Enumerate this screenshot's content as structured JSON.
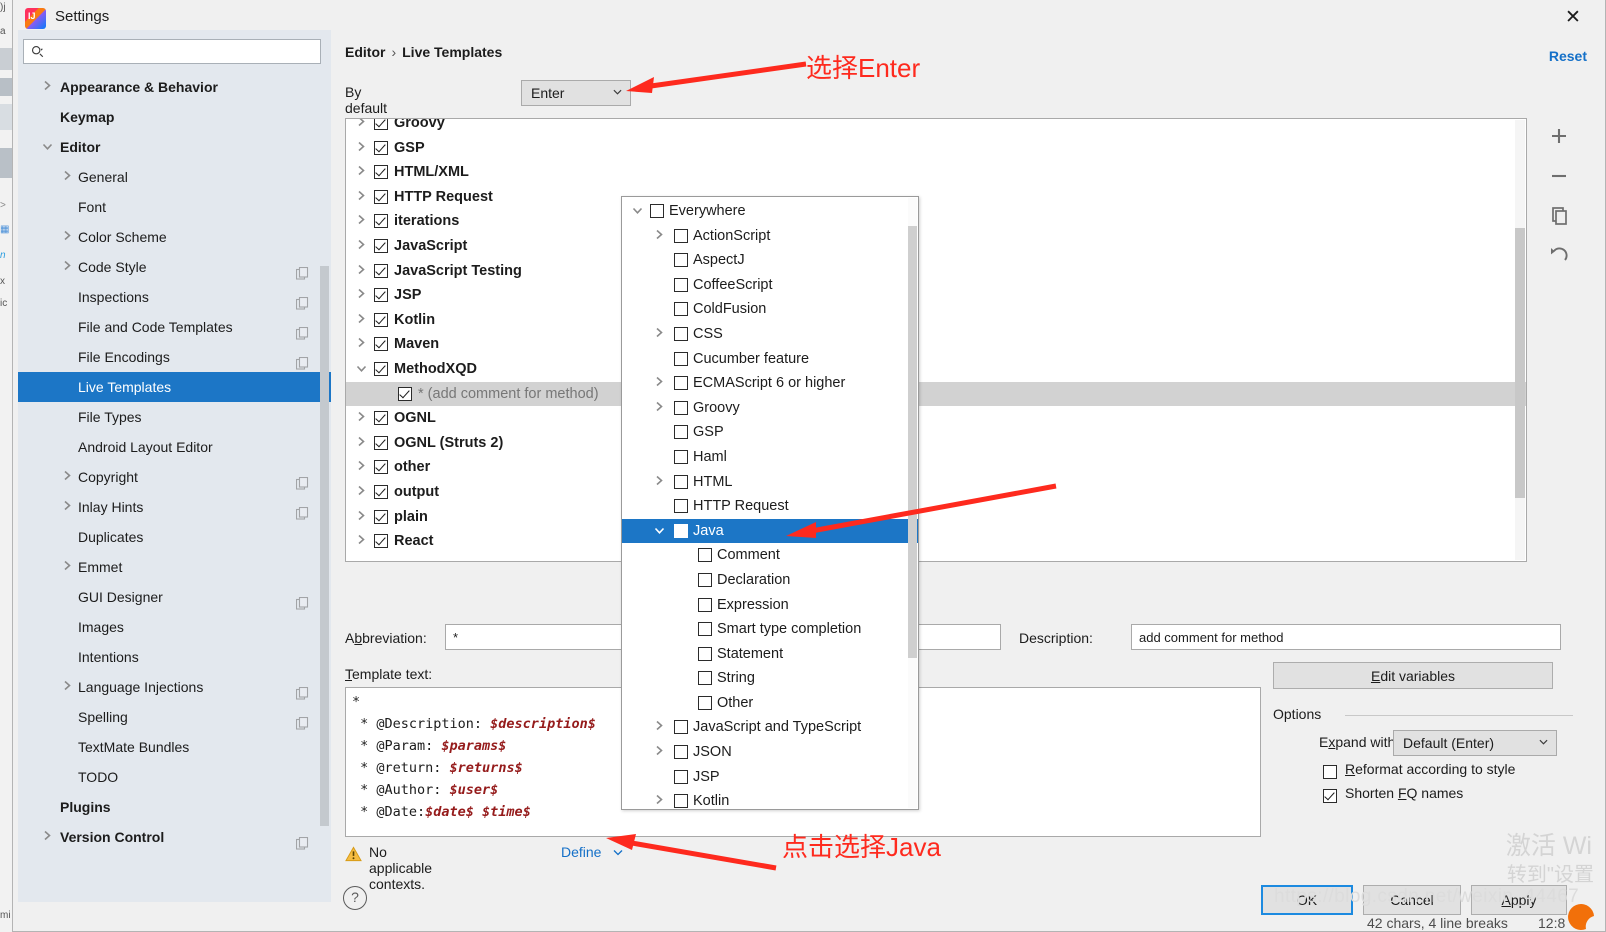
{
  "window": {
    "title": "Settings",
    "app_icon": "intellij-idea-icon",
    "close_icon": "close-icon"
  },
  "sidebar": {
    "search": {
      "placeholder": "",
      "value": "",
      "icon": "search-icon"
    },
    "items": [
      {
        "label": "Appearance & Behavior",
        "level": 0,
        "chevron": "right",
        "bold": true,
        "selected": false,
        "config_icon": false
      },
      {
        "label": "Keymap",
        "level": 0,
        "chevron": "",
        "bold": true,
        "selected": false,
        "config_icon": false
      },
      {
        "label": "Editor",
        "level": 0,
        "chevron": "down",
        "bold": true,
        "selected": false,
        "config_icon": false
      },
      {
        "label": "General",
        "level": 1,
        "chevron": "right",
        "bold": false,
        "selected": false,
        "config_icon": false
      },
      {
        "label": "Font",
        "level": 1,
        "chevron": "",
        "bold": false,
        "selected": false,
        "config_icon": false
      },
      {
        "label": "Color Scheme",
        "level": 1,
        "chevron": "right",
        "bold": false,
        "selected": false,
        "config_icon": false
      },
      {
        "label": "Code Style",
        "level": 1,
        "chevron": "right",
        "bold": false,
        "selected": false,
        "config_icon": true
      },
      {
        "label": "Inspections",
        "level": 1,
        "chevron": "",
        "bold": false,
        "selected": false,
        "config_icon": true
      },
      {
        "label": "File and Code Templates",
        "level": 1,
        "chevron": "",
        "bold": false,
        "selected": false,
        "config_icon": true
      },
      {
        "label": "File Encodings",
        "level": 1,
        "chevron": "",
        "bold": false,
        "selected": false,
        "config_icon": true
      },
      {
        "label": "Live Templates",
        "level": 1,
        "chevron": "",
        "bold": false,
        "selected": true,
        "config_icon": false
      },
      {
        "label": "File Types",
        "level": 1,
        "chevron": "",
        "bold": false,
        "selected": false,
        "config_icon": false
      },
      {
        "label": "Android Layout Editor",
        "level": 1,
        "chevron": "",
        "bold": false,
        "selected": false,
        "config_icon": false
      },
      {
        "label": "Copyright",
        "level": 1,
        "chevron": "right",
        "bold": false,
        "selected": false,
        "config_icon": true
      },
      {
        "label": "Inlay Hints",
        "level": 1,
        "chevron": "right",
        "bold": false,
        "selected": false,
        "config_icon": true
      },
      {
        "label": "Duplicates",
        "level": 1,
        "chevron": "",
        "bold": false,
        "selected": false,
        "config_icon": false
      },
      {
        "label": "Emmet",
        "level": 1,
        "chevron": "right",
        "bold": false,
        "selected": false,
        "config_icon": false
      },
      {
        "label": "GUI Designer",
        "level": 1,
        "chevron": "",
        "bold": false,
        "selected": false,
        "config_icon": true
      },
      {
        "label": "Images",
        "level": 1,
        "chevron": "",
        "bold": false,
        "selected": false,
        "config_icon": false
      },
      {
        "label": "Intentions",
        "level": 1,
        "chevron": "",
        "bold": false,
        "selected": false,
        "config_icon": false
      },
      {
        "label": "Language Injections",
        "level": 1,
        "chevron": "right",
        "bold": false,
        "selected": false,
        "config_icon": true
      },
      {
        "label": "Spelling",
        "level": 1,
        "chevron": "",
        "bold": false,
        "selected": false,
        "config_icon": true
      },
      {
        "label": "TextMate Bundles",
        "level": 1,
        "chevron": "",
        "bold": false,
        "selected": false,
        "config_icon": false
      },
      {
        "label": "TODO",
        "level": 1,
        "chevron": "",
        "bold": false,
        "selected": false,
        "config_icon": false
      },
      {
        "label": "Plugins",
        "level": 0,
        "chevron": "",
        "bold": true,
        "selected": false,
        "config_icon": false
      },
      {
        "label": "Version Control",
        "level": 0,
        "chevron": "right",
        "bold": true,
        "selected": false,
        "config_icon": true
      }
    ]
  },
  "header": {
    "breadcrumb_root": "Editor",
    "breadcrumb_sep": "›",
    "breadcrumb_leaf": "Live Templates",
    "reset_label": "Reset"
  },
  "expand": {
    "label": "By default expand with",
    "value": "Enter"
  },
  "templates": {
    "rows": [
      {
        "label": "Groovy",
        "chevron": "right",
        "checked": true,
        "child": false
      },
      {
        "label": "GSP",
        "chevron": "right",
        "checked": true,
        "child": false
      },
      {
        "label": "HTML/XML",
        "chevron": "right",
        "checked": true,
        "child": false
      },
      {
        "label": "HTTP Request",
        "chevron": "right",
        "checked": true,
        "child": false
      },
      {
        "label": "iterations",
        "chevron": "right",
        "checked": true,
        "child": false
      },
      {
        "label": "JavaScript",
        "chevron": "right",
        "checked": true,
        "child": false
      },
      {
        "label": "JavaScript Testing",
        "chevron": "right",
        "checked": true,
        "child": false
      },
      {
        "label": "JSP",
        "chevron": "right",
        "checked": true,
        "child": false
      },
      {
        "label": "Kotlin",
        "chevron": "right",
        "checked": true,
        "child": false
      },
      {
        "label": "Maven",
        "chevron": "right",
        "checked": true,
        "child": false
      },
      {
        "label": "MethodXQD",
        "chevron": "down",
        "checked": true,
        "child": false
      },
      {
        "label": "* (add comment for method)",
        "chevron": "",
        "checked": true,
        "child": true
      },
      {
        "label": "OGNL",
        "chevron": "right",
        "checked": true,
        "child": false
      },
      {
        "label": "OGNL (Struts 2)",
        "chevron": "right",
        "checked": true,
        "child": false
      },
      {
        "label": "other",
        "chevron": "right",
        "checked": true,
        "child": false
      },
      {
        "label": "output",
        "chevron": "right",
        "checked": true,
        "child": false
      },
      {
        "label": "plain",
        "chevron": "right",
        "checked": true,
        "child": false
      },
      {
        "label": "React",
        "chevron": "right",
        "checked": true,
        "child": false
      }
    ],
    "toolbar": [
      {
        "icon": "plus-icon",
        "name": "add-template-button"
      },
      {
        "icon": "minus-icon",
        "name": "remove-template-button"
      },
      {
        "icon": "copy-icon",
        "name": "duplicate-template-button"
      },
      {
        "icon": "undo-icon",
        "name": "restore-defaults-button"
      }
    ]
  },
  "editor": {
    "abbreviation_label": "Abbreviation:",
    "abbreviation_value": "*",
    "description_label": "Description:",
    "description_value": "add comment for method",
    "template_text_label": "Template text:",
    "template_lines": [
      {
        "prefix": "*",
        "var": "",
        "suffix": ""
      },
      {
        "prefix": " * @Description: ",
        "var": "$description$",
        "suffix": ""
      },
      {
        "prefix": " * @Param: ",
        "var": "$params$",
        "suffix": ""
      },
      {
        "prefix": " * @return: ",
        "var": "$returns$",
        "suffix": ""
      },
      {
        "prefix": " * @Author: ",
        "var": "$user$",
        "suffix": ""
      },
      {
        "prefix": " * @Date:",
        "var": "$date$ $time$",
        "suffix": ""
      }
    ],
    "warning_text": "No applicable contexts.",
    "warning_icon": "warning-triangle-icon",
    "define_link": "Define"
  },
  "options": {
    "edit_variables_label": "Edit variables",
    "group_title": "Options",
    "expand_with_label": "Expand with",
    "expand_with_value": "Default (Enter)",
    "reformat_label": "Reformat according to style",
    "reformat_checked": false,
    "shorten_label": "Shorten FQ names",
    "shorten_checked": true
  },
  "context_popup": {
    "rows": [
      {
        "label": "Everywhere",
        "level": 0,
        "chevron": "down",
        "selected": false
      },
      {
        "label": "ActionScript",
        "level": 1,
        "chevron": "right",
        "selected": false
      },
      {
        "label": "AspectJ",
        "level": 1,
        "chevron": "",
        "selected": false
      },
      {
        "label": "CoffeeScript",
        "level": 1,
        "chevron": "",
        "selected": false
      },
      {
        "label": "ColdFusion",
        "level": 1,
        "chevron": "",
        "selected": false
      },
      {
        "label": "CSS",
        "level": 1,
        "chevron": "right",
        "selected": false
      },
      {
        "label": "Cucumber feature",
        "level": 1,
        "chevron": "",
        "selected": false
      },
      {
        "label": "ECMAScript 6 or higher",
        "level": 1,
        "chevron": "right",
        "selected": false
      },
      {
        "label": "Groovy",
        "level": 1,
        "chevron": "right",
        "selected": false
      },
      {
        "label": "GSP",
        "level": 1,
        "chevron": "",
        "selected": false
      },
      {
        "label": "Haml",
        "level": 1,
        "chevron": "",
        "selected": false
      },
      {
        "label": "HTML",
        "level": 1,
        "chevron": "right",
        "selected": false
      },
      {
        "label": "HTTP Request",
        "level": 1,
        "chevron": "",
        "selected": false
      },
      {
        "label": "Java",
        "level": 1,
        "chevron": "down",
        "selected": true
      },
      {
        "label": "Comment",
        "level": 2,
        "chevron": "",
        "selected": false
      },
      {
        "label": "Declaration",
        "level": 2,
        "chevron": "",
        "selected": false
      },
      {
        "label": "Expression",
        "level": 2,
        "chevron": "",
        "selected": false
      },
      {
        "label": "Smart type completion",
        "level": 2,
        "chevron": "",
        "selected": false
      },
      {
        "label": "Statement",
        "level": 2,
        "chevron": "",
        "selected": false
      },
      {
        "label": "String",
        "level": 2,
        "chevron": "",
        "selected": false
      },
      {
        "label": "Other",
        "level": 2,
        "chevron": "",
        "selected": false
      },
      {
        "label": "JavaScript and TypeScript",
        "level": 1,
        "chevron": "right",
        "selected": false
      },
      {
        "label": "JSON",
        "level": 1,
        "chevron": "right",
        "selected": false
      },
      {
        "label": "JSP",
        "level": 1,
        "chevron": "",
        "selected": false
      },
      {
        "label": "Kotlin",
        "level": 1,
        "chevron": "right",
        "selected": false
      }
    ]
  },
  "footer": {
    "ok_label": "OK",
    "cancel_label": "Cancel",
    "apply_label": "Apply",
    "help_label": "?"
  },
  "annotations": [
    {
      "text": "选择Enter",
      "name": "annotation-select-enter"
    },
    {
      "text": "点击选择Java",
      "name": "annotation-click-select-java"
    }
  ],
  "watermarks": {
    "activate_line1": "激活 Wi",
    "activate_line2": "转到\"设置",
    "url": "https://blog.csdn.net/weixin_44467",
    "status_text": "42 chars, 4 line breaks",
    "status_caret": "12:8"
  },
  "colors": {
    "accent": "#1c76c6",
    "link": "#1470c8",
    "annotation": "#fe2a1e",
    "variable": "#951b1b"
  }
}
